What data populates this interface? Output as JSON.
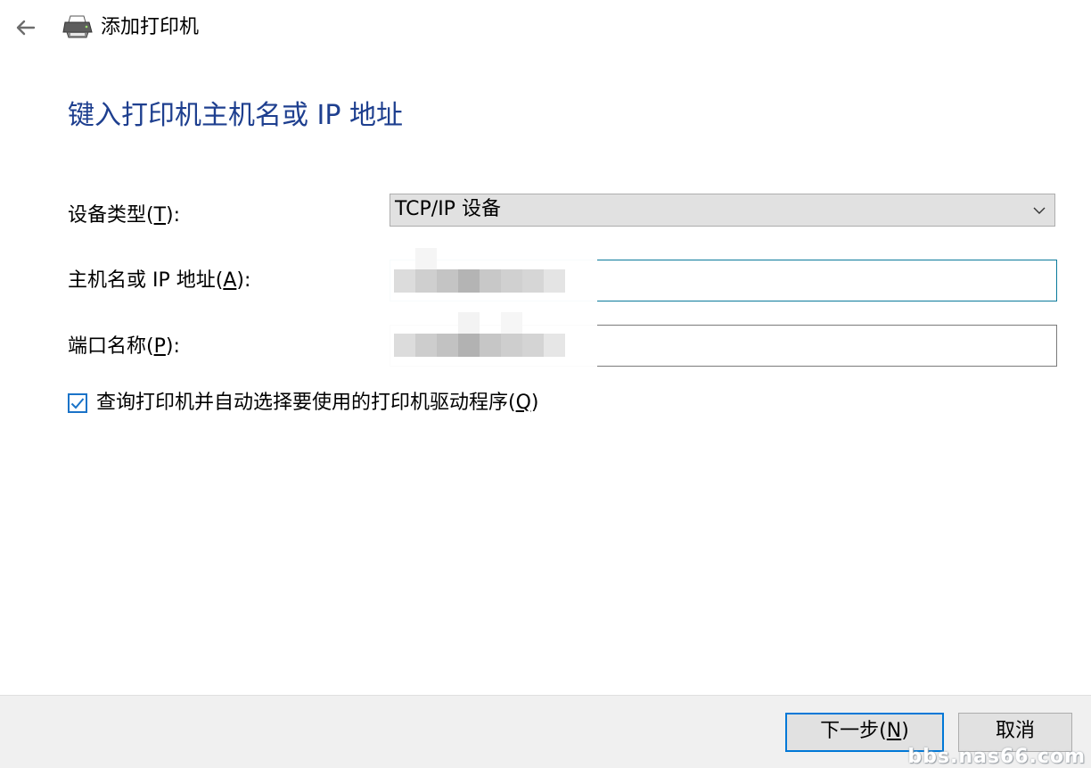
{
  "window": {
    "title": "添加打印机"
  },
  "heading": "键入打印机主机名或 IP 地址",
  "form": {
    "device_type": {
      "label_text": "设备类型(",
      "label_key": "T",
      "label_tail": "):",
      "selected": "TCP/IP 设备"
    },
    "hostname": {
      "label_text": "主机名或 IP 地址(",
      "label_key": "A",
      "label_tail": "):",
      "value": ""
    },
    "port_name": {
      "label_text": "端口名称(",
      "label_key": "P",
      "label_tail": "):",
      "value": ""
    },
    "query_checkbox": {
      "checked": true,
      "label_text": "查询打印机并自动选择要使用的打印机驱动程序(",
      "label_key": "Q",
      "label_tail": ")"
    }
  },
  "buttons": {
    "next": {
      "text": "下一步(",
      "key": "N",
      "tail": ")"
    },
    "cancel": {
      "text": "取消"
    }
  },
  "watermark": "bbs.nas66.com",
  "colors": {
    "heading": "#1e3f8f",
    "accent": "#0078d7",
    "footer_bg": "#f0f0f0"
  }
}
